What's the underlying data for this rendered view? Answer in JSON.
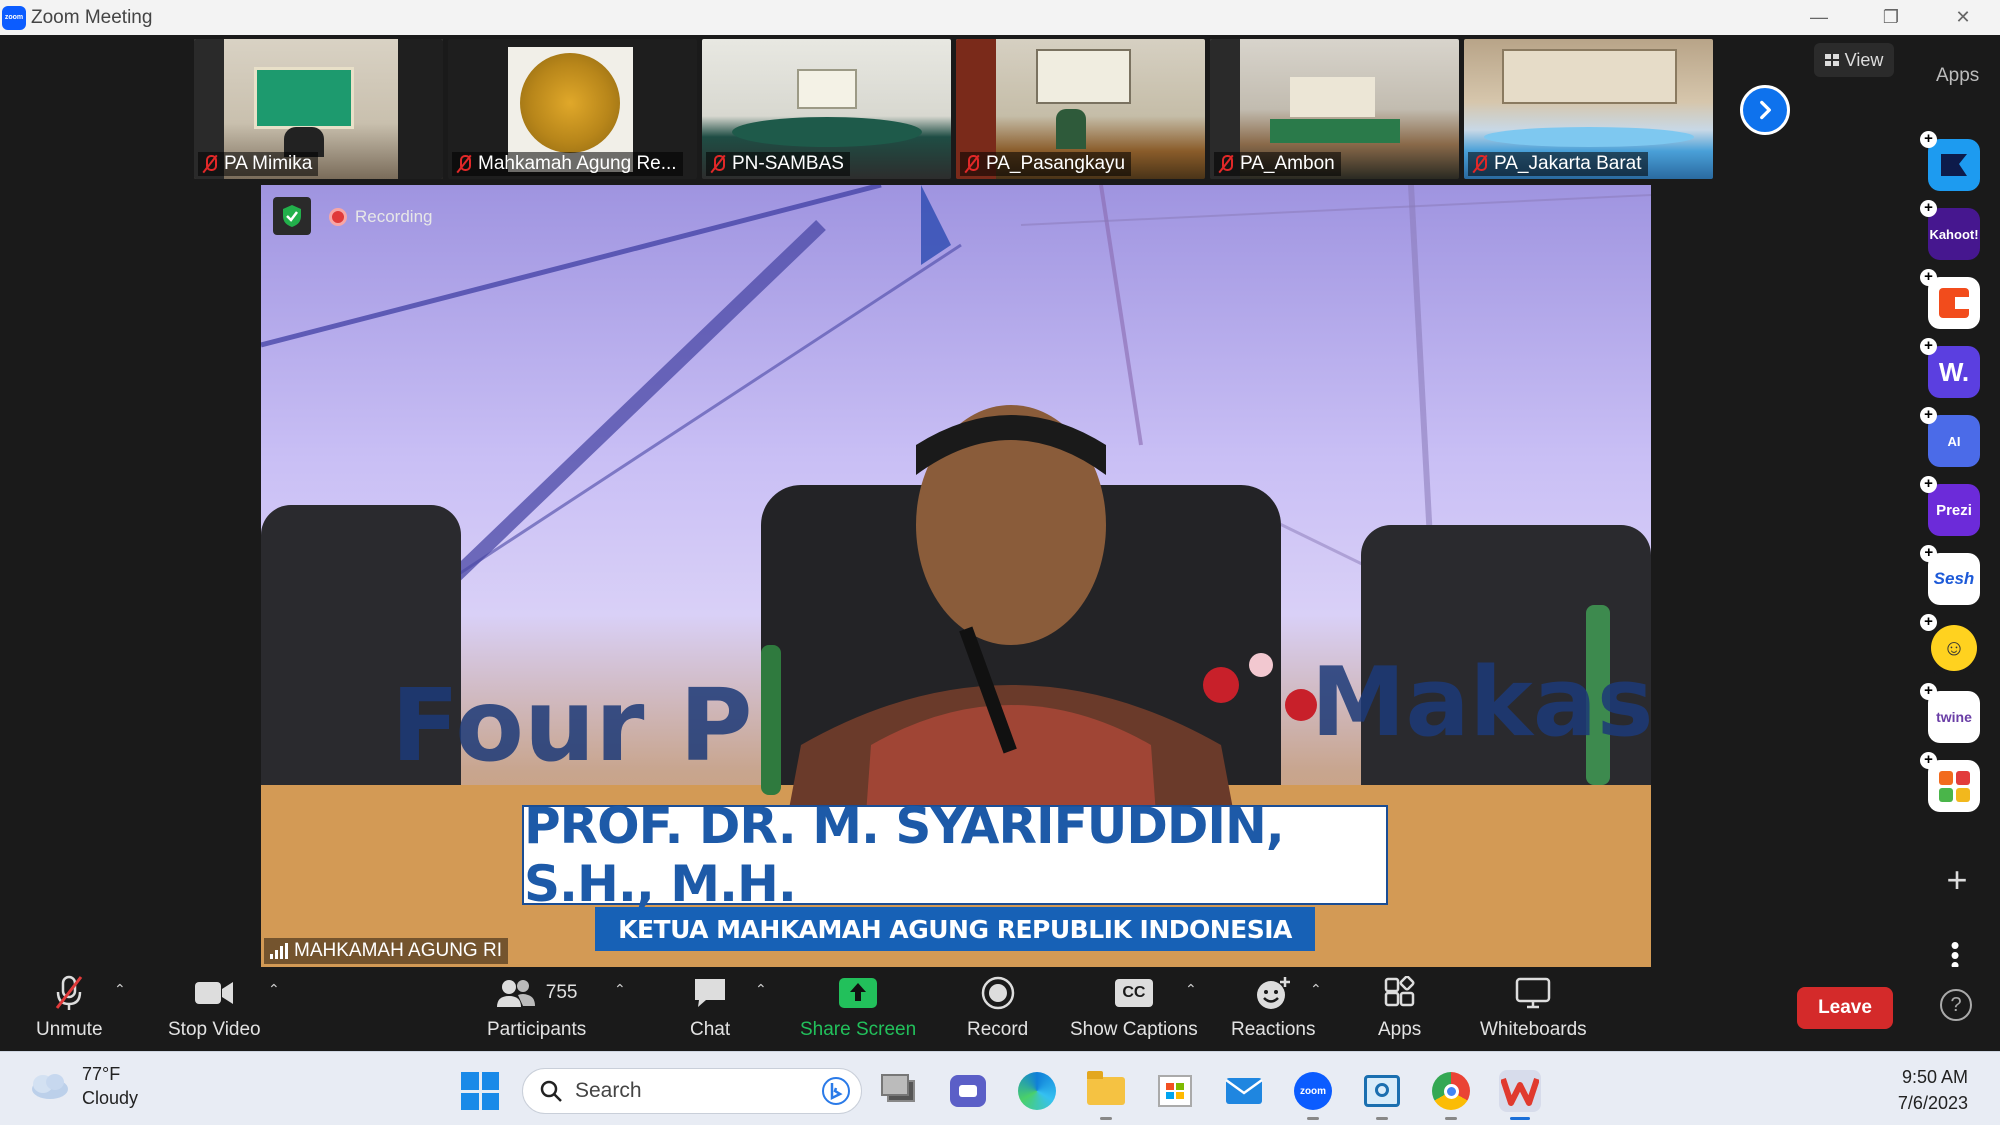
{
  "window": {
    "title": "Zoom Meeting",
    "logo_text": "zoom"
  },
  "gallery": {
    "participants": [
      {
        "name": "PA Mimika"
      },
      {
        "name": "Mahkamah Agung Re..."
      },
      {
        "name": "PN-SAMBAS"
      },
      {
        "name": "PA_Pasangkayu"
      },
      {
        "name": "PA_Ambon"
      },
      {
        "name": "PA_Jakarta Barat"
      }
    ],
    "view_label": "View"
  },
  "apps_panel": {
    "title": "Apps",
    "apps": [
      {
        "name": "pitch",
        "label": "",
        "color": "#1d9bf0"
      },
      {
        "name": "kahoot",
        "label": "Kahoot!",
        "color": "#46178f"
      },
      {
        "name": "c-app",
        "label": "",
        "color": "#ffffff"
      },
      {
        "name": "wooclap",
        "label": "W.",
        "color": "#5b3fe0"
      },
      {
        "name": "ai-app",
        "label": "AI",
        "color": "#4b6be8"
      },
      {
        "name": "prezi",
        "label": "Prezi",
        "color": "#6c2bd9"
      },
      {
        "name": "sesh",
        "label": "Sesh",
        "color": "#ffffff"
      },
      {
        "name": "emoji-app",
        "label": "",
        "color": "#ffd21f"
      },
      {
        "name": "twine",
        "label": "twine",
        "color": "#ffffff"
      },
      {
        "name": "blocks-app",
        "label": "",
        "color": "#ffffff"
      }
    ]
  },
  "main_video": {
    "recording_label": "Recording",
    "speaker_name": "MAHKAMAH AGUNG RI",
    "caption_name": "PROF. DR. M. SYARIFUDDIN, S.H., M.H.",
    "caption_title": "KETUA MAHKAMAH AGUNG REPUBLIK INDONESIA",
    "backdrop_text": "Four P",
    "backdrop_text2": "Makas"
  },
  "toolbar": {
    "unmute": "Unmute",
    "stop_video": "Stop Video",
    "participants": "Participants",
    "participant_count": "755",
    "chat": "Chat",
    "share_screen": "Share Screen",
    "record": "Record",
    "show_captions": "Show Captions",
    "captions_icon_text": "CC",
    "reactions": "Reactions",
    "apps": "Apps",
    "whiteboards": "Whiteboards",
    "leave": "Leave",
    "help": "?"
  },
  "taskbar": {
    "weather_temp": "77°F",
    "weather_desc": "Cloudy",
    "search_placeholder": "Search",
    "zoom_icon_text": "zoom",
    "time": "9:50 AM",
    "date": "7/6/2023"
  },
  "colors": {
    "share_green": "#22c05b",
    "leave_red": "#d42a2a",
    "accent_blue": "#0e72ed"
  }
}
